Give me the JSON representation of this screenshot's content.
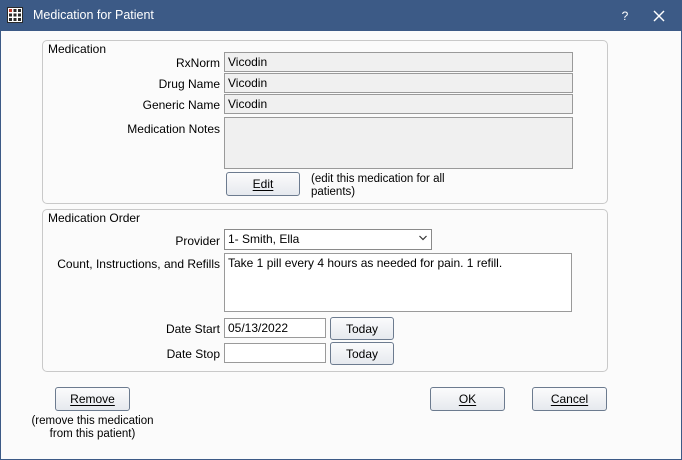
{
  "window": {
    "title": "Medication for Patient",
    "help_label": "?",
    "app_icon": "grid-app-icon",
    "close_icon": "close-icon"
  },
  "medication": {
    "group_title": "Medication",
    "rxnorm_label": "RxNorm",
    "rxnorm_value": "Vicodin",
    "drug_name_label": "Drug Name",
    "drug_name_value": "Vicodin",
    "generic_name_label": "Generic Name",
    "generic_name_value": "Vicodin",
    "notes_label": "Medication Notes",
    "notes_value": "",
    "edit_label": "Edit",
    "edit_note": "(edit this medication for all patients)"
  },
  "order": {
    "group_title": "Medication Order",
    "provider_label": "Provider",
    "provider_value": "1- Smith, Ella",
    "instructions_label": "Count, Instructions, and Refills",
    "instructions_value": "Take 1 pill every 4 hours as needed for pain. 1 refill.",
    "date_start_label": "Date Start",
    "date_start_value": "05/13/2022",
    "date_stop_label": "Date Stop",
    "date_stop_value": "",
    "today_label": "Today"
  },
  "footer": {
    "remove_label": "Remove",
    "remove_note": "(remove this medication from this patient)",
    "ok_label": "OK",
    "cancel_label": "Cancel"
  }
}
